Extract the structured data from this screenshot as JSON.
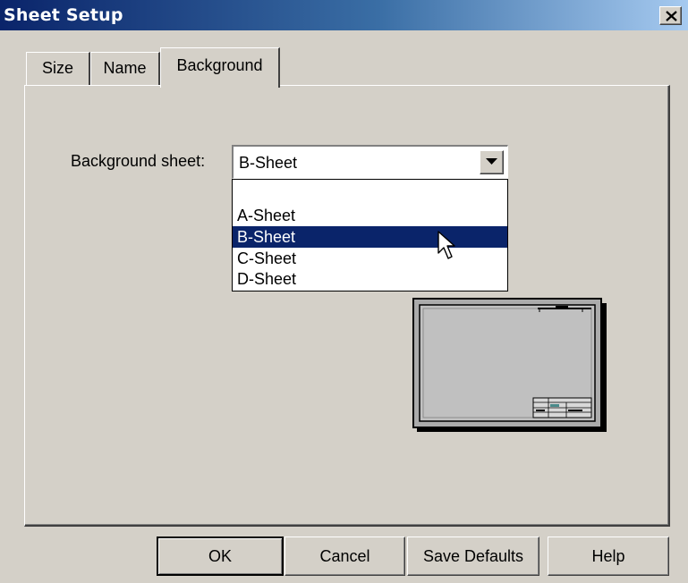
{
  "window": {
    "title": "Sheet Setup",
    "close_label": "close"
  },
  "tabs": [
    {
      "label": "Size"
    },
    {
      "label": "Name"
    },
    {
      "label": "Background",
      "active": true
    }
  ],
  "background": {
    "label": "Background sheet:",
    "selected_value": "B-Sheet",
    "options": [
      "",
      "A-Sheet",
      "B-Sheet",
      "C-Sheet",
      "D-Sheet"
    ],
    "highlighted_option": "B-Sheet"
  },
  "buttons": {
    "ok": "OK",
    "cancel": "Cancel",
    "save_defaults": "Save Defaults",
    "help": "Help"
  },
  "colors": {
    "face": "#d4d0c8",
    "title_start": "#0a246a",
    "title_end": "#a6caf0",
    "selection": "#0a246a"
  },
  "icons": {
    "close": "close-icon",
    "dropdown": "chevron-down-icon",
    "cursor": "mouse-pointer-icon"
  }
}
